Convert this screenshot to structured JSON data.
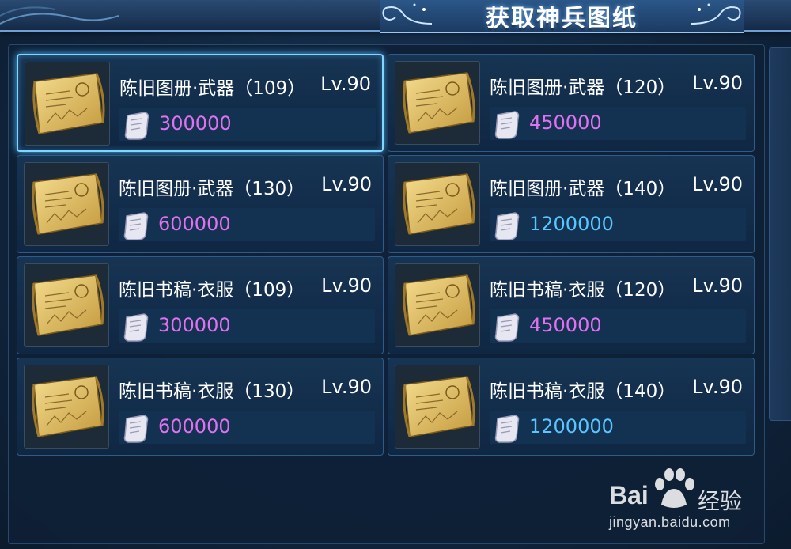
{
  "title": "获取神兵图纸",
  "items": [
    {
      "name": "陈旧图册·武器（109）",
      "level": "Lv.90",
      "price": "300000",
      "price_color": "magenta",
      "selected": true
    },
    {
      "name": "陈旧图册·武器（120）",
      "level": "Lv.90",
      "price": "450000",
      "price_color": "magenta",
      "selected": false
    },
    {
      "name": "陈旧图册·武器（130）",
      "level": "Lv.90",
      "price": "600000",
      "price_color": "magenta",
      "selected": false
    },
    {
      "name": "陈旧图册·武器（140）",
      "level": "Lv.90",
      "price": "1200000",
      "price_color": "cyan",
      "selected": false
    },
    {
      "name": "陈旧书稿·衣服（109）",
      "level": "Lv.90",
      "price": "300000",
      "price_color": "magenta",
      "selected": false
    },
    {
      "name": "陈旧书稿·衣服（120）",
      "level": "Lv.90",
      "price": "450000",
      "price_color": "magenta",
      "selected": false
    },
    {
      "name": "陈旧书稿·衣服（130）",
      "level": "Lv.90",
      "price": "600000",
      "price_color": "magenta",
      "selected": false
    },
    {
      "name": "陈旧书稿·衣服（140）",
      "level": "Lv.90",
      "price": "1200000",
      "price_color": "cyan",
      "selected": false
    }
  ],
  "icons": {
    "item": "blueprint-scroll-icon",
    "currency": "silver-scroll-currency-icon"
  },
  "colors": {
    "magenta_price": "#e072f0",
    "cyan_price": "#59c6ff",
    "selected_border": "#7fd6ff"
  },
  "watermark": {
    "logo_text": "Bai",
    "logo_suffix": "经验",
    "url": "jingyan.baidu.com"
  }
}
